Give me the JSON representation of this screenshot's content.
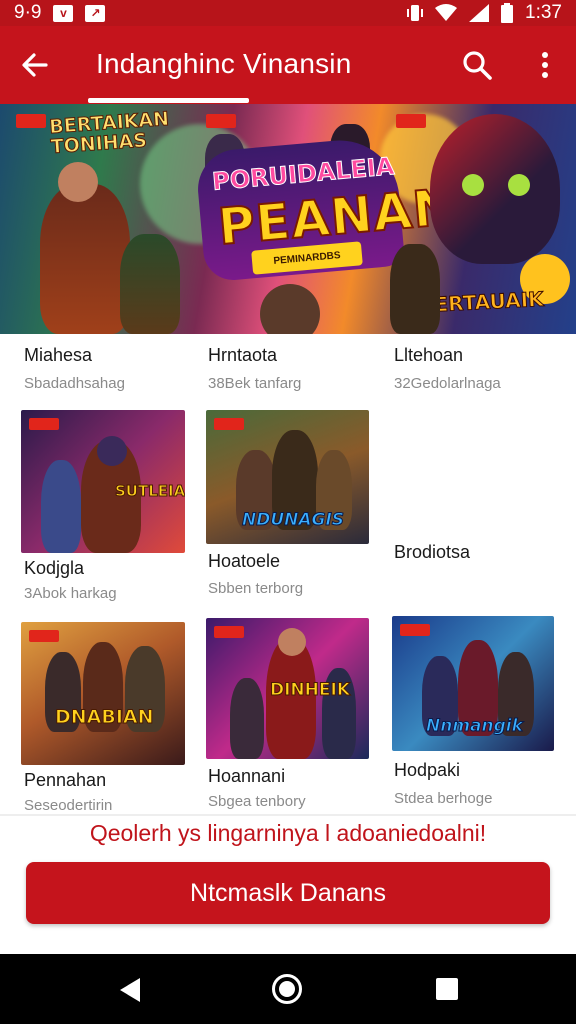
{
  "status_bar": {
    "left_text": "9·9",
    "time": "1:37",
    "icons": [
      "notification-app-icon",
      "notification-edit-icon",
      "vibrate-icon",
      "wifi-icon",
      "signal-icon",
      "battery-icon"
    ]
  },
  "app_bar": {
    "title": "Indanghinc Vinansin",
    "back_icon": "arrow-back-icon",
    "search_icon": "search-icon",
    "more_icon": "more-vert-icon"
  },
  "hero": {
    "logo_left": "BERTAIKAN\nTONIHAS",
    "logo_center_top": "PORUIDALEIA",
    "logo_center_big": "PEANAN",
    "ribbon": "PEMINARDBS",
    "logo_right": "SERTAUAIK"
  },
  "grid": [
    {
      "name": "Miahesa",
      "subtitle": "Sbadadhsahag"
    },
    {
      "name": "Hrntaota",
      "subtitle": "38Bek tanfarg"
    },
    {
      "name": "Lltehoan",
      "subtitle": "32Gedolarlnaga"
    },
    {
      "name": "Kodjgla",
      "subtitle": "3Abok harkag",
      "logo": "SUTLEIAN"
    },
    {
      "name": "Hoatoele",
      "subtitle": "Sbben terborg",
      "logo": "NDUNAGIS"
    },
    {
      "name": "Brodiotsa",
      "subtitle": ""
    },
    {
      "name": "Pennahan",
      "subtitle": "Seseodertirin",
      "logo": "DNABIAN"
    },
    {
      "name": "Hoannani",
      "subtitle": "Sbgea tenbory",
      "logo": "DINHEIK"
    },
    {
      "name": "Hodpaki",
      "subtitle": "Stdea berhoge",
      "logo": "Nnmangik"
    }
  ],
  "promo_text": "Qeolerh ys lingarninya l adoaniedoalni!",
  "cta_label": "Ntcmaslk Danans",
  "nav_bar": {
    "back": "nav-back-icon",
    "home": "nav-home-icon",
    "recents": "nav-recents-icon"
  },
  "colors": {
    "primary": "#c5141c",
    "status_bar": "#b7141a",
    "accent_text": "#c0141b"
  }
}
